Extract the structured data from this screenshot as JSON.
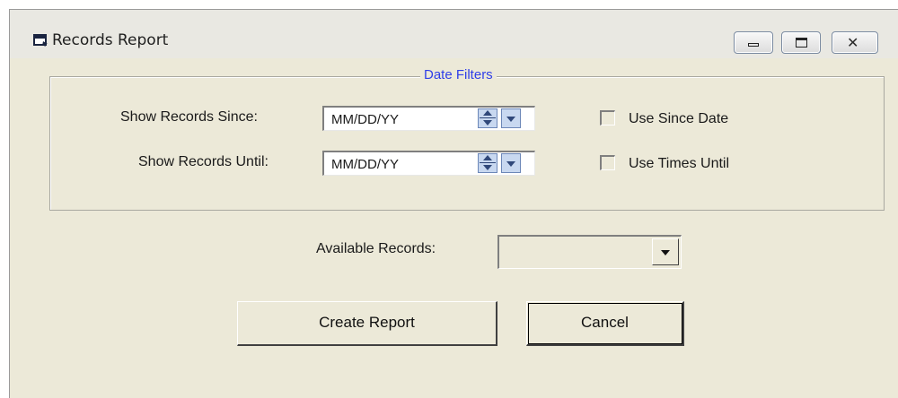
{
  "window": {
    "title": "Records Report",
    "controls": {
      "minimize_icon": "minimize-icon",
      "maximize_icon": "maximize-icon",
      "close_icon": "close-icon",
      "close_glyph": "✕"
    }
  },
  "date_filters": {
    "legend": "Date Filters",
    "since": {
      "label": "Show Records  Since:",
      "value": "MM/DD/YY",
      "checkbox_label": "Use Since Date",
      "checked": false
    },
    "until": {
      "label": "Show Records Until:",
      "value": "MM/DD/YY",
      "checkbox_label": "Use Times Until",
      "checked": false
    }
  },
  "records": {
    "label": "Available Records:",
    "selected": ""
  },
  "actions": {
    "create_label": "Create Report",
    "cancel_label": "Cancel"
  },
  "colors": {
    "window_bg": "#ece9d8",
    "legend_text": "#2f3fe8",
    "spin_bg": "#c8d8f0"
  }
}
